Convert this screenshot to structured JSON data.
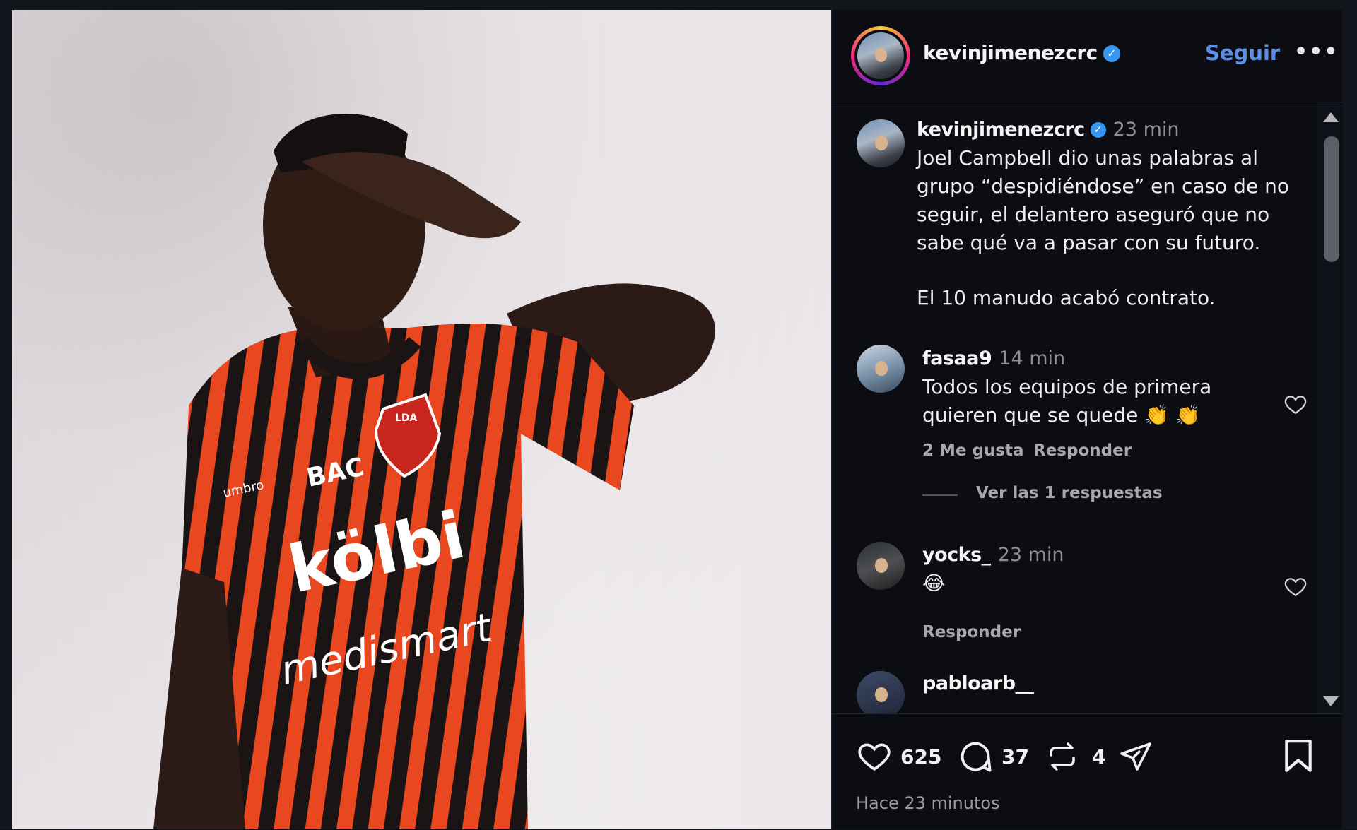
{
  "post": {
    "username": "kevinjimenezcrc",
    "follow_label": "Seguir",
    "more_label": "•••",
    "caption_time": "23 min",
    "caption_lines": [
      "Joel Campbell dio unas palabras al",
      "grupo “despidiéndose” en caso de no",
      "seguir, el delantero aseguró que no",
      "sabe qué va a pasar con su futuro.",
      "El 10 manudo acabó contrato."
    ],
    "jersey_text": {
      "brand1": "umbro",
      "brand2": "BAC",
      "brand3": "kölbi",
      "brand4": "medismart",
      "crest": "LDA"
    }
  },
  "comments": [
    {
      "username": "fasaa9",
      "time": "14 min",
      "lines": [
        "Todos los equipos de primera",
        "quieren que se quede 👏 👏"
      ],
      "likes_label": "2 Me gusta",
      "reply_label": "Responder",
      "view_replies": "Ver las 1 respuestas"
    },
    {
      "username": "yocks_",
      "time": "23 min",
      "lines": [
        "😂"
      ],
      "reply_label": "Responder"
    },
    {
      "username": "pabloarb__"
    }
  ],
  "footer": {
    "likes": "625",
    "comments": "37",
    "reposts": "4",
    "time_ago": "Hace 23 minutos"
  },
  "colors": {
    "accent_blue": "#5b8fe8",
    "verified_blue": "#3897f0",
    "jersey_orange": "#e8471f",
    "jersey_black": "#1a1414"
  },
  "icons": [
    "verified-icon",
    "more-icon",
    "heart-icon",
    "comment-icon",
    "repost-icon",
    "share-icon",
    "bookmark-icon",
    "scroll-up-icon",
    "scroll-down-icon"
  ]
}
